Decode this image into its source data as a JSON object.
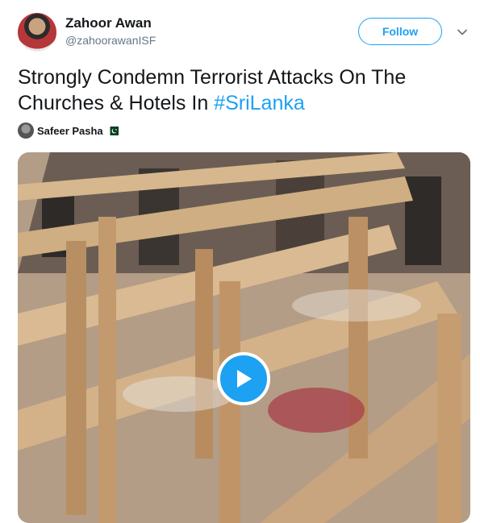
{
  "tweet": {
    "author": {
      "display_name": "Zahoor Awan",
      "handle": "@zahoorawanISF",
      "avatar_icon": "profile-photo"
    },
    "follow_label": "Follow",
    "menu_icon": "chevron-down-icon",
    "text_before": "Strongly Condemn Terrorist Attacks On The Churches & Hotels In ",
    "hashtag": "#SriLanka",
    "via": {
      "name": "Safeer Pasha",
      "flag_icon": "pakistan-flag-icon"
    },
    "media": {
      "type": "video",
      "play_icon": "play-icon"
    }
  },
  "colors": {
    "accent": "#1da1f2",
    "text": "#14171a",
    "secondary": "#657786"
  }
}
